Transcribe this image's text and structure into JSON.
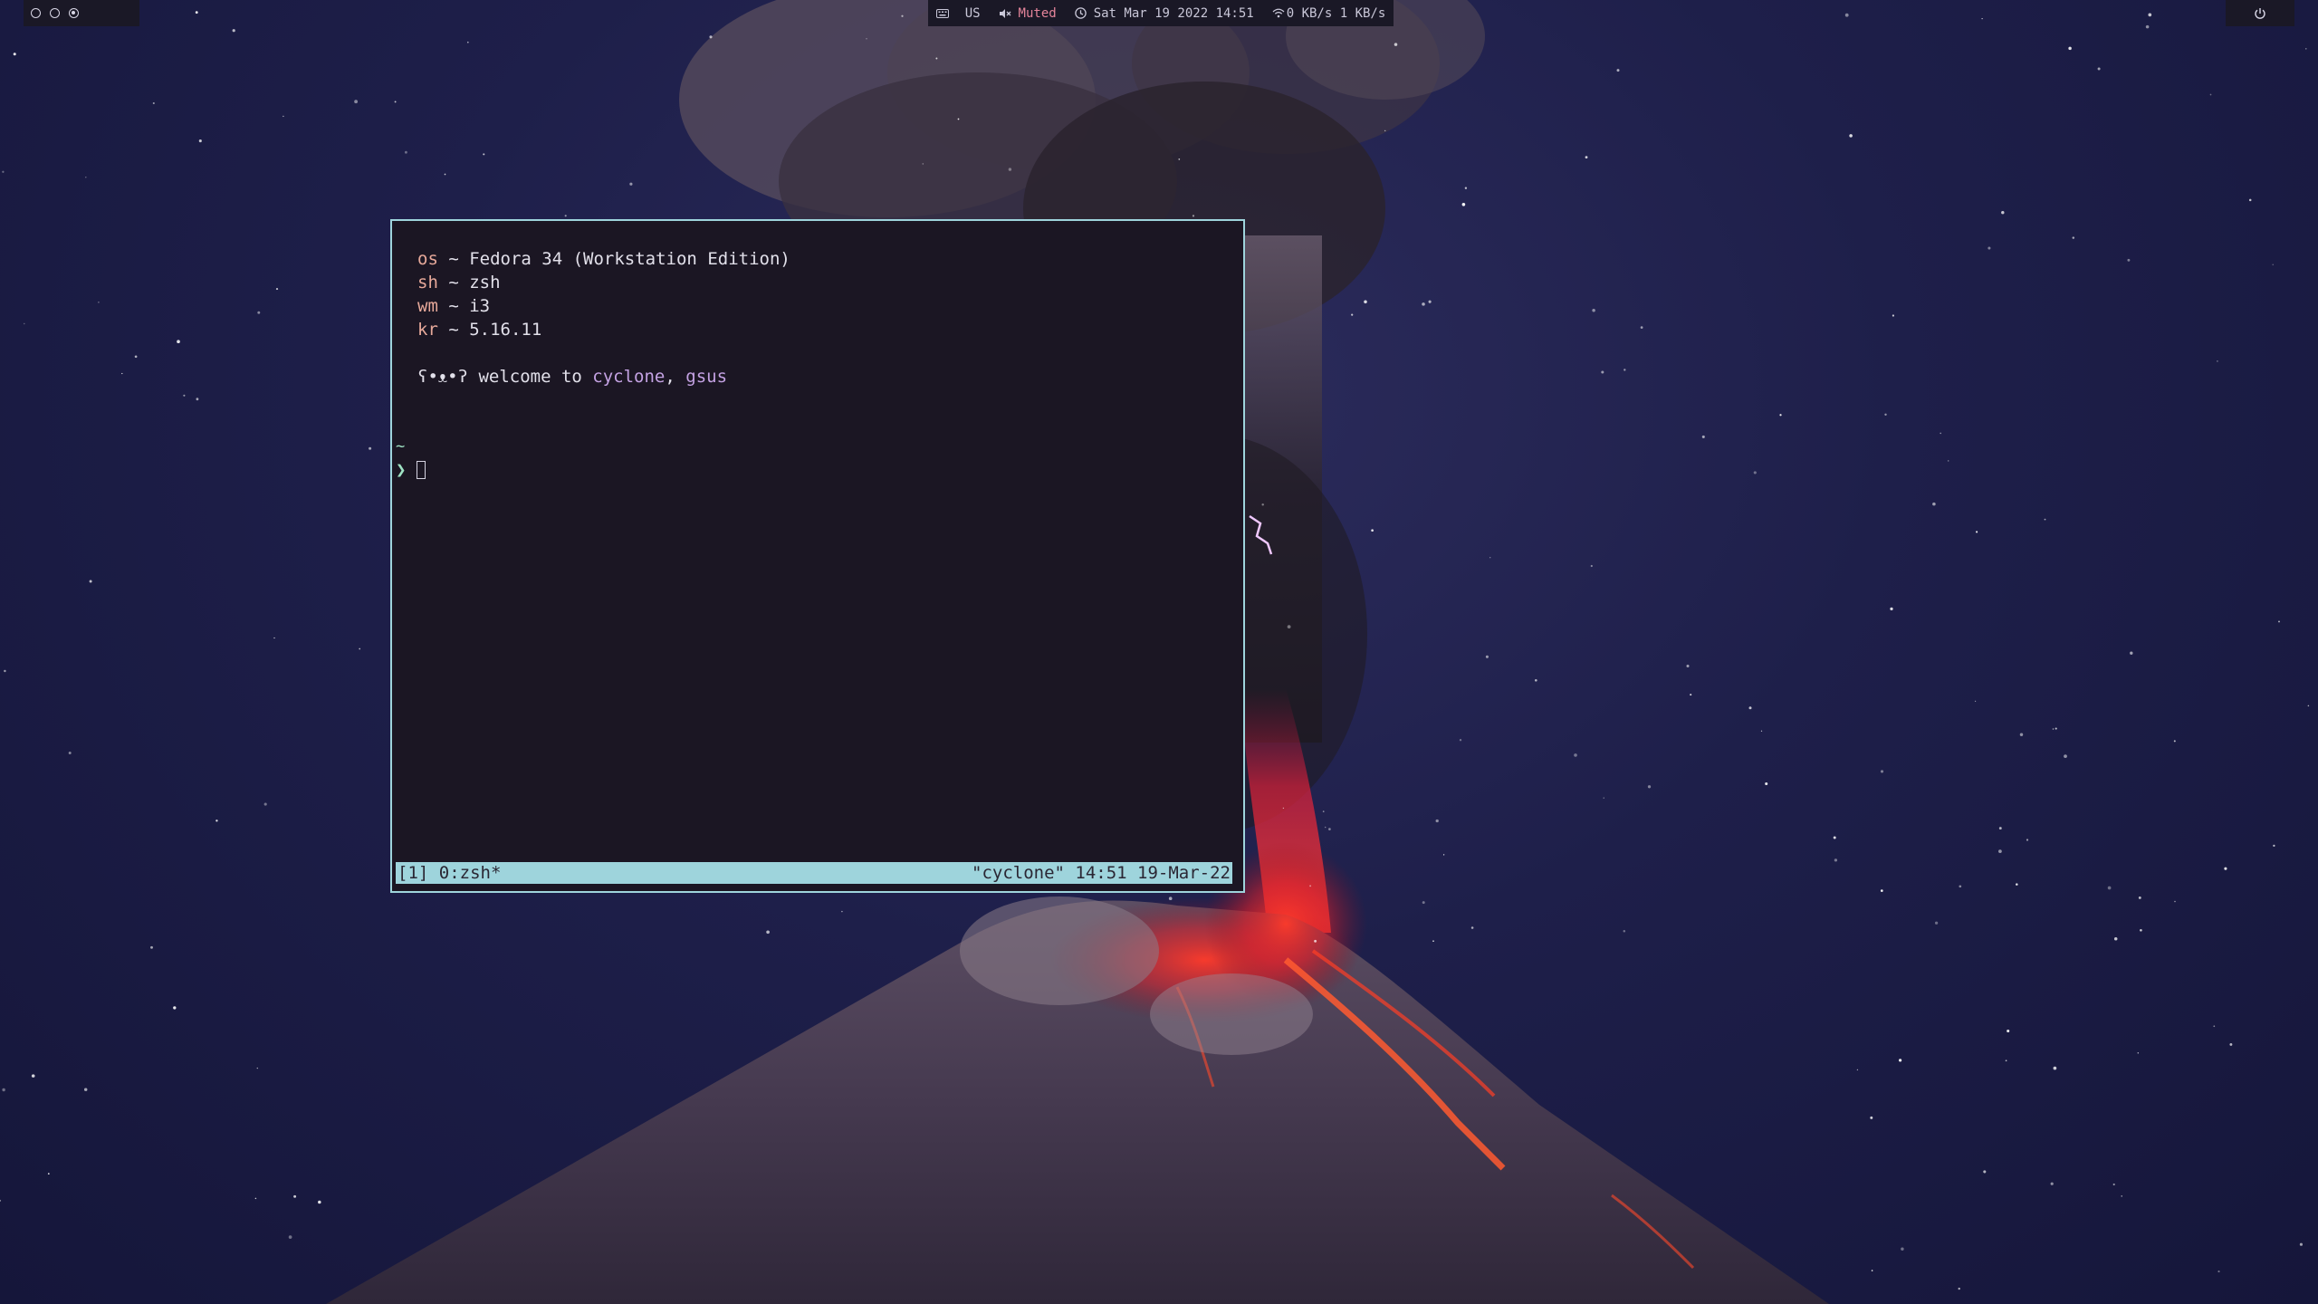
{
  "topbar": {
    "workspaces": [
      {
        "name": "workspace-1",
        "active": false
      },
      {
        "name": "workspace-2",
        "active": false
      },
      {
        "name": "workspace-3",
        "active": true
      }
    ],
    "status": {
      "keyboard_icon": "keyboard-icon",
      "layout": "US",
      "volume_icon": "speaker-muted-icon",
      "volume": "Muted",
      "clock_icon": "clock-icon",
      "datetime": "Sat Mar 19 2022 14:51",
      "wifi_icon": "wifi-icon",
      "network": "0 KB/s 1 KB/s"
    },
    "power_icon": "power-icon"
  },
  "terminal": {
    "sysinfo": [
      {
        "key": "os",
        "sep": " ~ ",
        "value": "Fedora 34 (Workstation Edition)"
      },
      {
        "key": "sh",
        "sep": " ~ ",
        "value": "zsh"
      },
      {
        "key": "wm",
        "sep": " ~ ",
        "value": "i3"
      },
      {
        "key": "kr",
        "sep": " ~ ",
        "value": "5.16.11"
      }
    ],
    "welcome": {
      "face": "ʕ•ᴥ•ʔ",
      "text": " welcome to ",
      "host": "cyclone",
      "comma": ", ",
      "user": "gsus"
    },
    "cwd": "~",
    "prompt": "❯"
  },
  "tmux": {
    "left": "[1] 0:zsh*",
    "right": "\"cyclone\" 14:51 19-Mar-22"
  },
  "colors": {
    "terminal_bg": "#1b1623",
    "terminal_border": "#9ed4dc",
    "tmux_bar": "#9ed4dc",
    "key": "#e7a99a",
    "highlight": "#c4a2e3",
    "muted": "#e4849a",
    "prompt": "#9fe3c4"
  }
}
